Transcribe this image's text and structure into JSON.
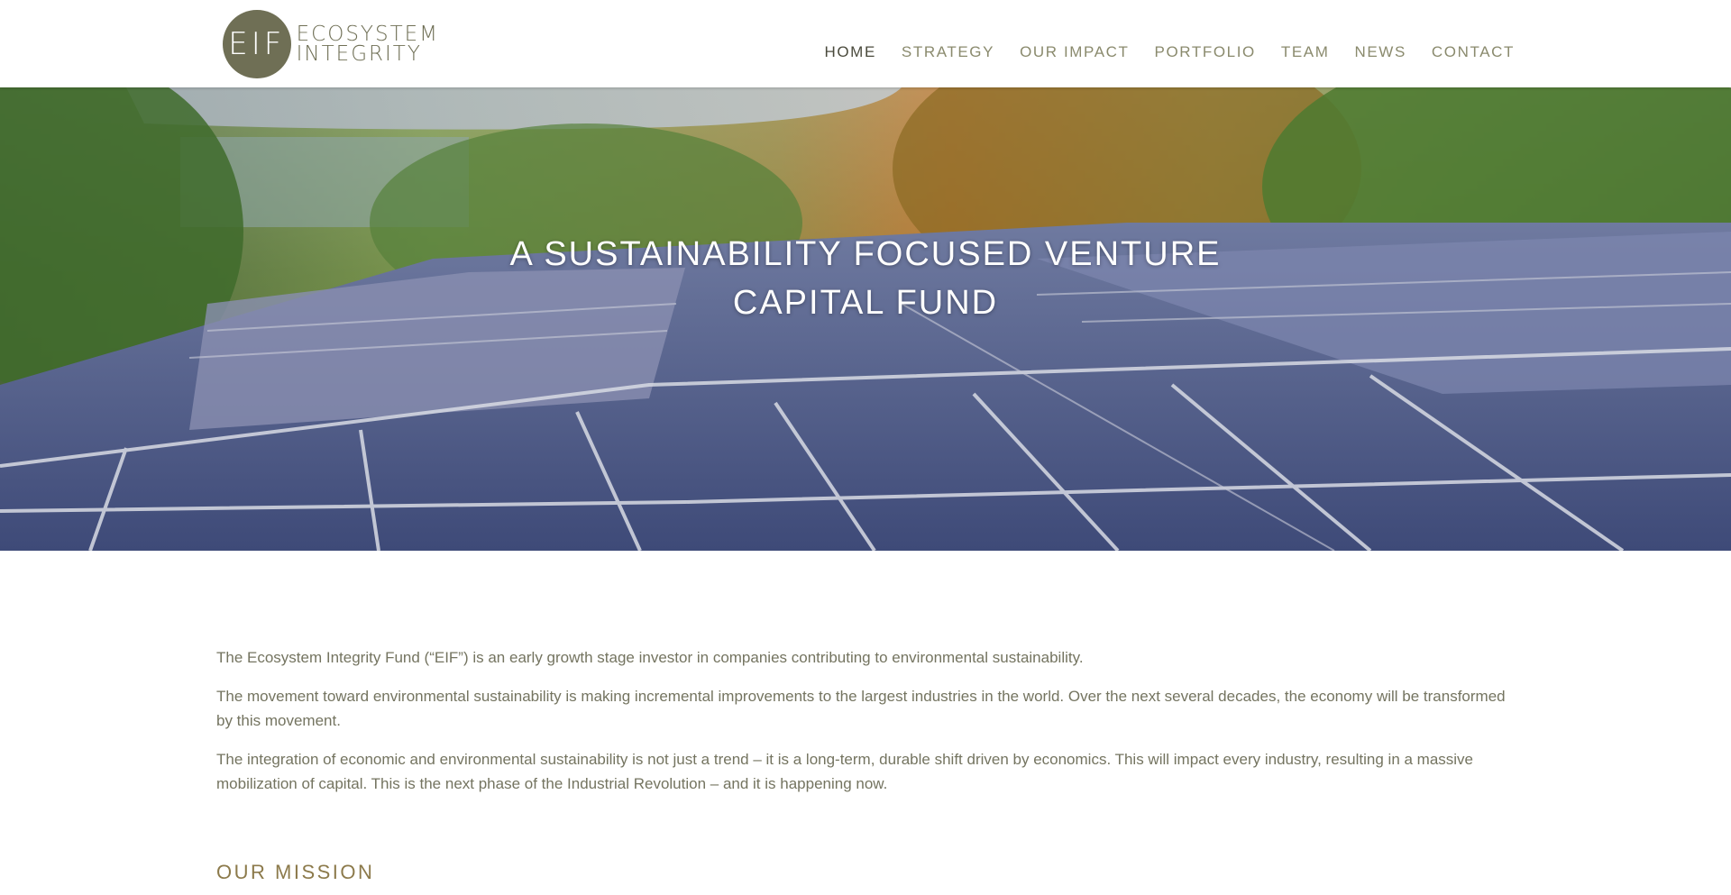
{
  "brand": {
    "monogram": "EIF",
    "line1": "ECOSYSTEM",
    "line2": "INTEGRITY"
  },
  "nav": {
    "items": [
      "HOME",
      "STRATEGY",
      "OUR IMPACT",
      "PORTFOLIO",
      "TEAM",
      "NEWS",
      "CONTACT"
    ],
    "active": "HOME"
  },
  "hero": {
    "title_line1": "A SUSTAINABILITY FOCUSED VENTURE",
    "title_line2": "CAPITAL FUND",
    "image": "solar-panels-photo"
  },
  "intro": {
    "p1": "The Ecosystem Integrity Fund (“EIF”) is an early growth stage investor in companies contributing to environmental sustainability.",
    "p2": "The movement toward environmental sustainability is making incremental improvements to the largest industries in the world.  Over the next several decades, the economy will be transformed by this movement.",
    "p3": "The integration of economic and environmental sustainability is not just a trend – it is a long-term, durable shift driven by economics. This will impact every industry, resulting in a massive mobilization of capital.  This is the next phase of the Industrial Revolution – and it is happening now."
  },
  "mission": {
    "heading": "OUR MISSION"
  },
  "colors": {
    "brand_olive": "#6f6f55",
    "nav_text": "#8a8a6d",
    "nav_active": "#4a4a3c",
    "mission_heading": "#8c7a4b"
  }
}
